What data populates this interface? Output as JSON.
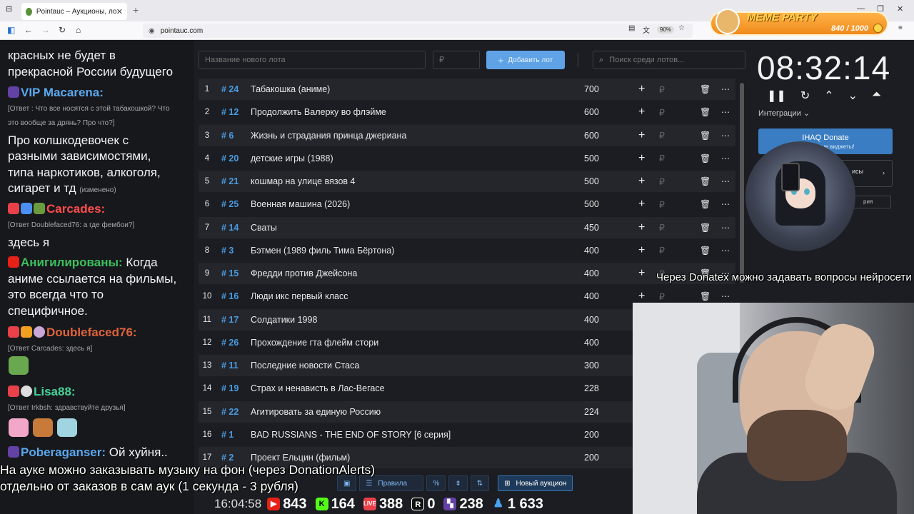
{
  "browser": {
    "tab_title": "Pointauc – Аукционы, лотереи",
    "url": "pointauc.com",
    "zoom": "90%"
  },
  "overlay": {
    "meme_title": "MEME PARTY",
    "meme_count": "840 / 1000"
  },
  "chat": {
    "messages": [
      {
        "text": "красных не будет в"
      },
      {
        "text": "прекрасной России будущего"
      },
      {
        "nick": "VIP Macarena:",
        "color": "#5aa9f0"
      },
      {
        "reply": "[Ответ : Что все носятся с этой табакошкой? Что"
      },
      {
        "reply": "это вообще за дрянь? Про что?]"
      },
      {
        "text": "Про колшкодевочек с"
      },
      {
        "text": "разными зависимостями,"
      },
      {
        "text": "типа наркотиков, алкоголя,"
      },
      {
        "text": "сигарет и тд",
        "edited": "(изменено)"
      },
      {
        "nick": "Carcades:",
        "color": "#ff4d4d"
      },
      {
        "reply": "[Ответ Doublefaced76: а где фембои?]"
      },
      {
        "text": "здесь я"
      },
      {
        "nick": "Анигилированы:",
        "color": "#3ac05c",
        "text": "Когда"
      },
      {
        "text": "аниме ссылается на фильмы,"
      },
      {
        "text": "это всегда что то"
      },
      {
        "text": "специфичное."
      },
      {
        "nick": "Doublefaced76:",
        "color": "#e0633c"
      },
      {
        "reply": "[Ответ Carcades: здесь я]"
      },
      {
        "nick": "Lisa88:",
        "color": "#47d39a"
      },
      {
        "reply": "[Ответ Irkbsh: здравствуйте друзья]"
      },
      {
        "nick": "Poberaganser:",
        "color": "#5aa9f0",
        "text": "Ой хуйня.."
      }
    ]
  },
  "auction": {
    "lot_name_placeholder": "Название нового лота",
    "amount_placeholder": "₽",
    "add_button": "Добавить лот",
    "search_placeholder": "Поиск среди лотов...",
    "rows": [
      {
        "idx": "1",
        "id": "# 24",
        "name": "Табакошка (аниме)",
        "amount": "700"
      },
      {
        "idx": "2",
        "id": "# 12",
        "name": "Продолжить Валерку во флэйме",
        "amount": "600"
      },
      {
        "idx": "3",
        "id": "# 6",
        "name": "Жизнь и страдания принца джериана",
        "amount": "600"
      },
      {
        "idx": "4",
        "id": "# 20",
        "name": "детские игры (1988)",
        "amount": "500"
      },
      {
        "idx": "5",
        "id": "# 21",
        "name": "кошмар на улице вязов 4",
        "amount": "500"
      },
      {
        "idx": "6",
        "id": "# 25",
        "name": "Военная машина (2026)",
        "amount": "500"
      },
      {
        "idx": "7",
        "id": "# 14",
        "name": "Сваты",
        "amount": "450"
      },
      {
        "idx": "8",
        "id": "# 3",
        "name": "Бэтмен (1989 филь Тима Бёртона)",
        "amount": "400"
      },
      {
        "idx": "9",
        "id": "# 15",
        "name": "Фредди против Джейсона",
        "amount": "400"
      },
      {
        "idx": "10",
        "id": "# 16",
        "name": "Люди икс первый класс",
        "amount": "400"
      },
      {
        "idx": "11",
        "id": "# 17",
        "name": "Солдатики 1998",
        "amount": "400"
      },
      {
        "idx": "12",
        "id": "# 26",
        "name": "Прохождение гта флейм стори",
        "amount": "400"
      },
      {
        "idx": "13",
        "id": "# 11",
        "name": "Последние новости Стаса",
        "amount": "300"
      },
      {
        "idx": "14",
        "id": "# 19",
        "name": "Страх и ненависть в Лас-Вегасе",
        "amount": "228"
      },
      {
        "idx": "15",
        "id": "# 22",
        "name": "Агитировать за единую Россию",
        "amount": "224"
      },
      {
        "idx": "16",
        "id": "# 1",
        "name": "BAD RUSSIANS - THE END OF STORY [6 серия]",
        "amount": "200"
      },
      {
        "idx": "17",
        "id": "# 2",
        "name": "Проект Ельцин (фильм)",
        "amount": "200"
      }
    ],
    "bottom": {
      "rules": "Правила",
      "new_auction": "Новый аукцион"
    }
  },
  "right_panel": {
    "timer": "08:32:14",
    "integrations": "Интеграции",
    "donate_title": "IHAQ Donate",
    "donate_sub": "уникальные виджеты!",
    "box2": "исы",
    "box3": "рия"
  },
  "subtitles": {
    "top_right": "Через Donatex можно задавать вопросы нейросети",
    "bottom_1": "На ауке можно заказывать музыку на фон (через DonationAlerts)",
    "bottom_2": "отдельно от заказов в сам аук (1 секунда - 3 рубля)"
  },
  "stats": {
    "clock": "16:04:58",
    "youtube": "843",
    "kick": "164",
    "live": "388",
    "r": "0",
    "twitch": "238",
    "viewers": "1 633"
  },
  "colors": {
    "accent": "#4a9be0",
    "button": "#5fa3e6",
    "bg": "#1b1d22"
  }
}
